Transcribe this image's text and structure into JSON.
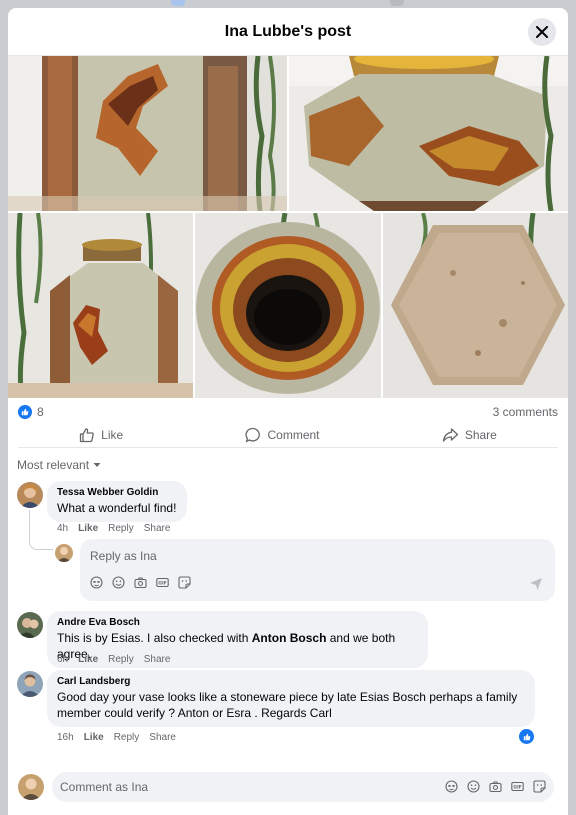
{
  "header": {
    "title": "Ina Lubbe's post"
  },
  "icons": {
    "close": "close-icon",
    "like": "thumbs-up-icon",
    "comment": "speech-bubble-icon",
    "share": "share-arrow-icon",
    "sort": "caret-down-icon",
    "send": "send-icon"
  },
  "colors": {
    "accent": "#1877f2",
    "bubble_bg": "#f0f2f5",
    "secondary_text": "#65676b"
  },
  "photos": [
    {
      "name": "photo-vase-side-closeup",
      "label": "Vase side close-up"
    },
    {
      "name": "photo-vase-shoulder",
      "label": "Vase shoulder view"
    },
    {
      "name": "photo-vase-full",
      "label": "Full vase"
    },
    {
      "name": "photo-vase-opening",
      "label": "Vase opening from above"
    },
    {
      "name": "photo-vase-base",
      "label": "Hexagonal base"
    }
  ],
  "reactions": {
    "like_count": "8",
    "comments_label": "3 comments"
  },
  "actions": {
    "like": "Like",
    "comment": "Comment",
    "share": "Share"
  },
  "sort": {
    "label": "Most relevant"
  },
  "comments": [
    {
      "author": "Tessa Webber Goldin",
      "text": "What a wonderful find!",
      "time": "4h",
      "like": "Like",
      "reply": "Reply",
      "share": "Share"
    },
    {
      "author": "Andre Eva Bosch",
      "text_before": "This is by Esias. I also checked with ",
      "text_bold": "Anton Bosch",
      "text_after": " and we both agree.",
      "time": "6h",
      "like": "Like",
      "reply": "Reply",
      "share": "Share"
    },
    {
      "author": "Carl Landsberg",
      "text": "Good day your vase looks like a stoneware piece by late Esias Bosch perhaps a family member could verify ? Anton or Esra . Regards Carl",
      "time": "16h",
      "like": "Like",
      "reply": "Reply",
      "share": "Share"
    }
  ],
  "reply_box": {
    "placeholder": "Reply as Ina"
  },
  "comment_box": {
    "placeholder": "Comment as Ina"
  },
  "composer_tools": [
    "avatar-sticker-icon",
    "emoji-icon",
    "camera-icon",
    "gif-icon",
    "sticker-icon"
  ]
}
